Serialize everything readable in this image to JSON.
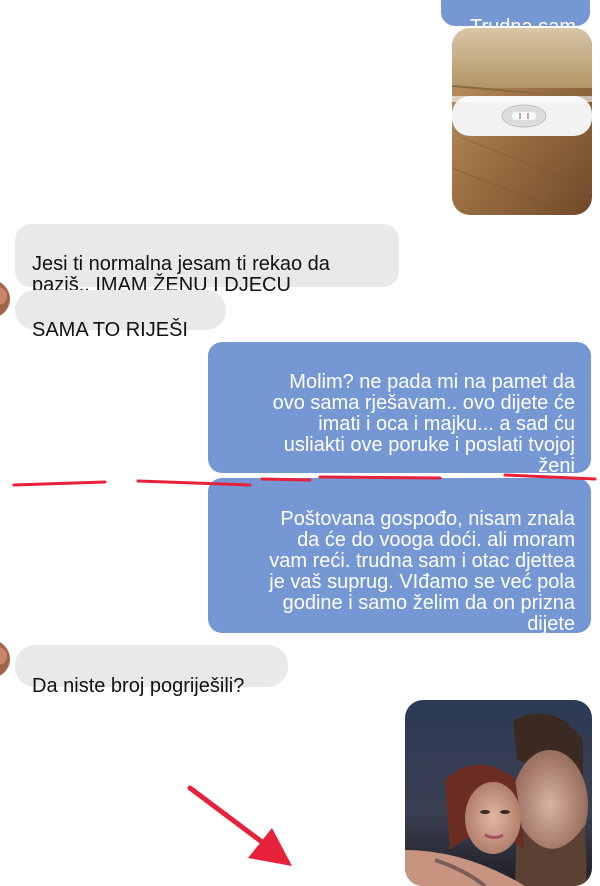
{
  "conversation": {
    "messages": [
      {
        "direction": "outgoing",
        "text": "Trudna sam"
      },
      {
        "direction": "outgoing",
        "type": "photo",
        "subject": "pregnancy-test-photo"
      },
      {
        "direction": "incoming",
        "text": "Jesi ti normalna jesam ti rekao da\npaziš.. IMAM ŽENU I DJECU"
      },
      {
        "direction": "incoming",
        "text": "SAMA TO RIJEŠI"
      },
      {
        "direction": "outgoing",
        "text": "Molim? ne pada mi na pamet da\novo sama rješavam.. ovo dijete će\nimati i oca i majku... a sad ću\nusliakti ove poruke i poslati tvojoj\nženi"
      },
      {
        "direction": "outgoing",
        "text": "Poštovana gospođo, nisam znala\nda će do vooga doći. ali moram\nvam reći. trudna sam i otac djettea\nje vaš suprug. VIđamo se već pola\ngodine i samo želim da on prizna\ndijete"
      },
      {
        "direction": "incoming",
        "text": "Da niste broj pogriješili?"
      },
      {
        "direction": "outgoing",
        "type": "photo",
        "subject": "couple-selfie-photo"
      }
    ]
  },
  "colors": {
    "outgoing_bubble": "#7598d4",
    "incoming_bubble": "#e9e9ec",
    "annotation_red": "#e8213a"
  },
  "annotations": {
    "dashed_line": "red-dashed-separator",
    "arrow": "red-arrow"
  }
}
